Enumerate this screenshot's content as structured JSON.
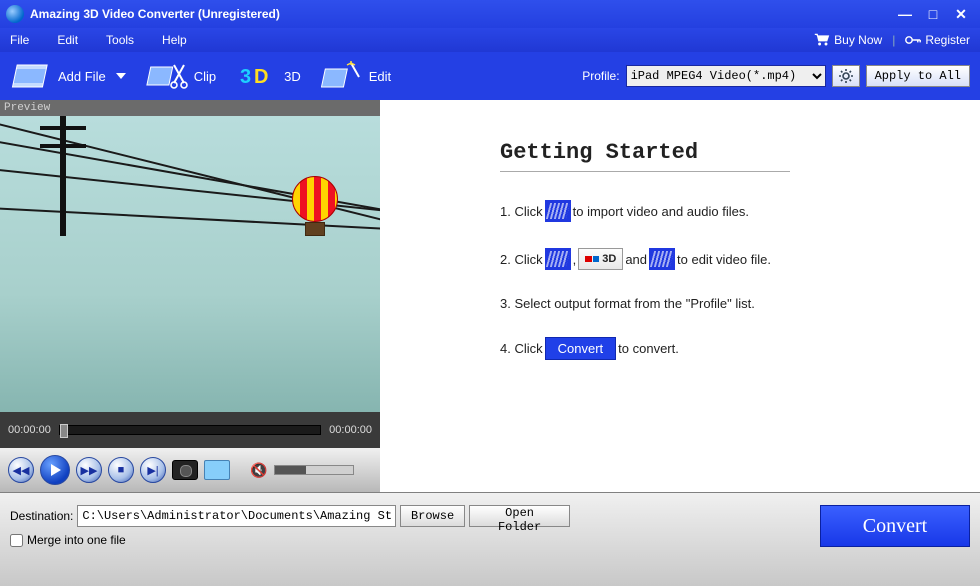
{
  "title": "Amazing 3D Video Converter (Unregistered)",
  "menu": {
    "file": "File",
    "edit": "Edit",
    "tools": "Tools",
    "help": "Help",
    "buy": "Buy Now",
    "register": "Register"
  },
  "toolbar": {
    "addfile": "Add File",
    "clip": "Clip",
    "3d": "3D",
    "edit": "Edit",
    "profile_label": "Profile:",
    "profile_value": "iPad MPEG4 Video(*.mp4)",
    "apply_all": "Apply to All"
  },
  "preview": {
    "label": "Preview",
    "time_current": "00:00:00",
    "time_total": "00:00:00"
  },
  "help": {
    "heading": "Getting Started",
    "s1a": "1. Click",
    "s1b": "to import video and audio files.",
    "s2a": "2. Click",
    "s2b": ",",
    "s2c": "and",
    "s2d": "to edit video file.",
    "s2_3d": "3D",
    "s3": "3. Select output format from the \"Profile\" list.",
    "s4a": "4. Click",
    "s4_btn": "Convert",
    "s4b": "to convert."
  },
  "bottom": {
    "dest_label": "Destination:",
    "dest_value": "C:\\Users\\Administrator\\Documents\\Amazing Studio\\",
    "browse": "Browse",
    "open_folder": "Open Folder",
    "merge": "Merge into one file",
    "convert": "Convert"
  }
}
